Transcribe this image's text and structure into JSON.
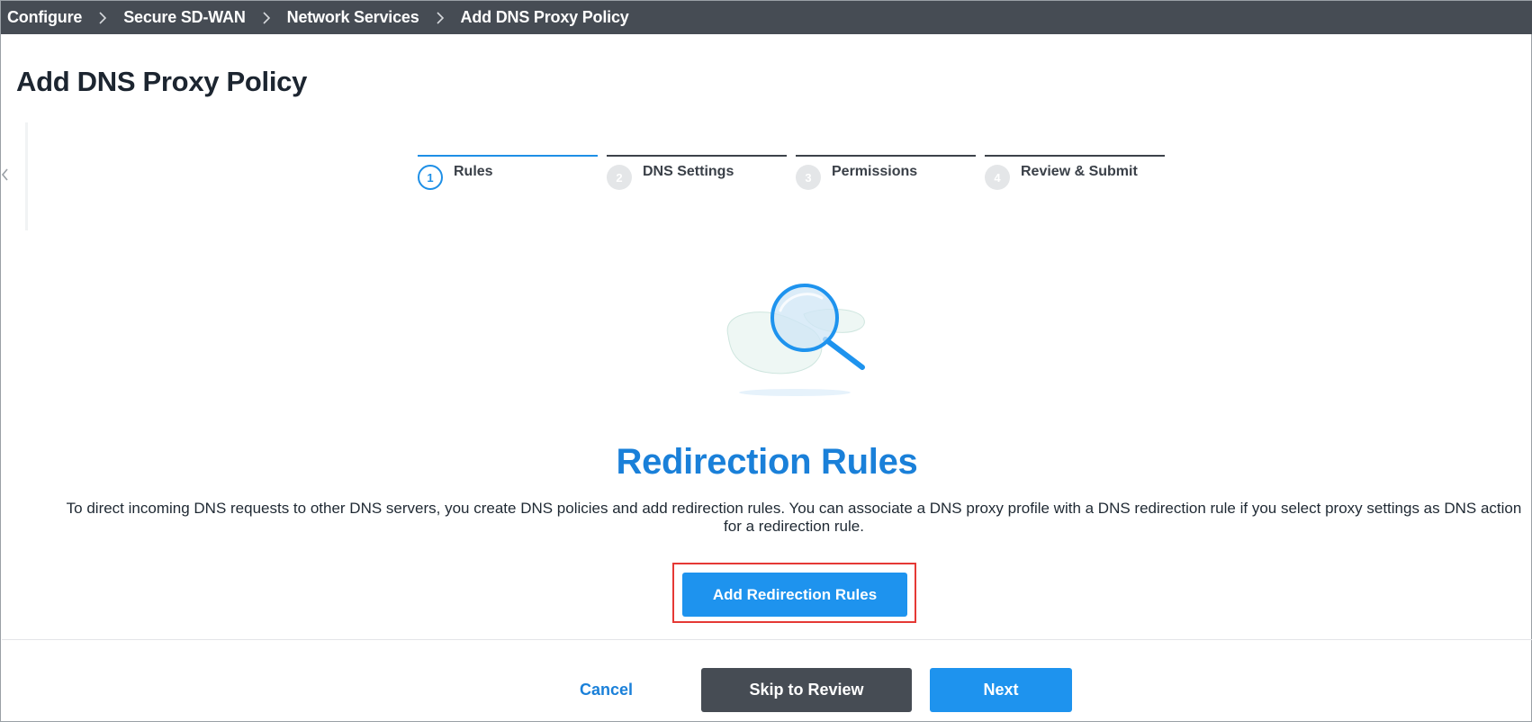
{
  "breadcrumb": {
    "items": [
      {
        "label": "Configure"
      },
      {
        "label": "Secure SD-WAN"
      },
      {
        "label": "Network Services"
      },
      {
        "label": "Add DNS Proxy Policy"
      }
    ],
    "separator_icon": "chevron-right-icon"
  },
  "page": {
    "title": "Add DNS Proxy Policy"
  },
  "stepper": {
    "active_index": 0,
    "steps": [
      {
        "number": "1",
        "label": "Rules"
      },
      {
        "number": "2",
        "label": "DNS Settings"
      },
      {
        "number": "3",
        "label": "Permissions"
      },
      {
        "number": "4",
        "label": "Review & Submit"
      }
    ]
  },
  "empty_state": {
    "illustration_icon": "magnifying-glass-icon",
    "title": "Redirection Rules",
    "description": "To direct incoming DNS requests to other DNS servers, you create DNS policies and add redirection rules. You can associate a DNS proxy profile with a DNS redirection rule if you select proxy settings as DNS action for a redirection rule.",
    "add_button_label": "Add Redirection Rules"
  },
  "footer": {
    "cancel_label": "Cancel",
    "skip_label": "Skip to Review",
    "next_label": "Next"
  },
  "colors": {
    "topbar": "#464c54",
    "accent": "#1e93ee",
    "title_blue": "#1a80d9",
    "highlight_border": "#e53935"
  }
}
